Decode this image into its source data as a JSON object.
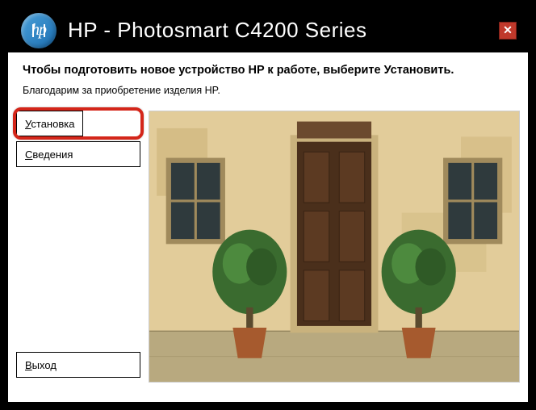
{
  "header": {
    "logo_text": "hp",
    "title": "HP - Photosmart C4200 Series",
    "close_glyph": "✕"
  },
  "intro": {
    "headline": "Чтобы подготовить новое устройство HP к работе, выберите Установить.",
    "thanks": "Благодарим за приобретение изделия HP."
  },
  "buttons": {
    "install_prefix": "У",
    "install_rest": "становка",
    "info_prefix": "С",
    "info_rest": "ведения",
    "exit_prefix": "В",
    "exit_rest": "ыход"
  },
  "colors": {
    "highlight": "#d4261a",
    "hp_blue": "#1c6fb3",
    "close_red": "#c0392b"
  }
}
